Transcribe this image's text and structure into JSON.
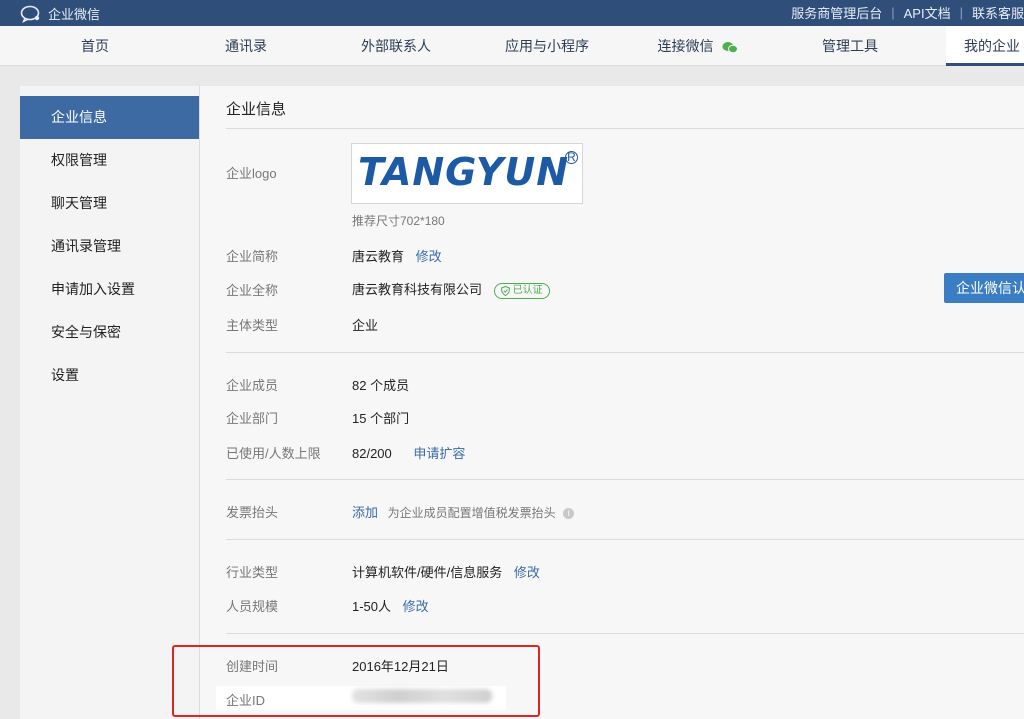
{
  "topbar": {
    "brand": "企业微信",
    "links": [
      "服务商管理后台",
      "API文档",
      "联系客服"
    ]
  },
  "nav": {
    "items": [
      "首页",
      "通讯录",
      "外部联系人",
      "应用与小程序",
      "连接微信",
      "管理工具",
      "我的企业"
    ],
    "active": "我的企业"
  },
  "sidebar": {
    "items": [
      "企业信息",
      "权限管理",
      "聊天管理",
      "通讯录管理",
      "申请加入设置",
      "安全与保密",
      "设置"
    ],
    "active": "企业信息"
  },
  "main": {
    "title": "企业信息",
    "logo": {
      "label": "企业logo",
      "logo_text": "TANGYUN",
      "logo_mark": "R",
      "hint": "推荐尺寸702*180"
    },
    "short_name": {
      "label": "企业简称",
      "value": "唐云教育",
      "action": "修改"
    },
    "full_name": {
      "label": "企业全称",
      "value": "唐云教育科技有限公司",
      "badge": "已认证"
    },
    "verify_button": "企业微信认",
    "entity_type": {
      "label": "主体类型",
      "value": "企业"
    },
    "members": {
      "label": "企业成员",
      "value": "82 个成员"
    },
    "departments": {
      "label": "企业部门",
      "value": "15 个部门"
    },
    "capacity": {
      "label": "已使用/人数上限",
      "value": "82/200",
      "action": "申请扩容"
    },
    "invoice": {
      "label": "发票抬头",
      "action": "添加",
      "desc": "为企业成员配置增值税发票抬头"
    },
    "industry": {
      "label": "行业类型",
      "value": "计算机软件/硬件/信息服务",
      "action": "修改"
    },
    "staff_size": {
      "label": "人员规模",
      "value": "1-50人",
      "action": "修改"
    },
    "created": {
      "label": "创建时间",
      "value": "2016年12月21日"
    },
    "corp_id": {
      "label": "企业ID"
    }
  },
  "colors": {
    "topbar": "#2f4f7a",
    "accent": "#3d6aa3",
    "link": "#3a6aa8",
    "button": "#3a7dc2",
    "verified": "#4caf50",
    "highlight": "#e02424"
  }
}
